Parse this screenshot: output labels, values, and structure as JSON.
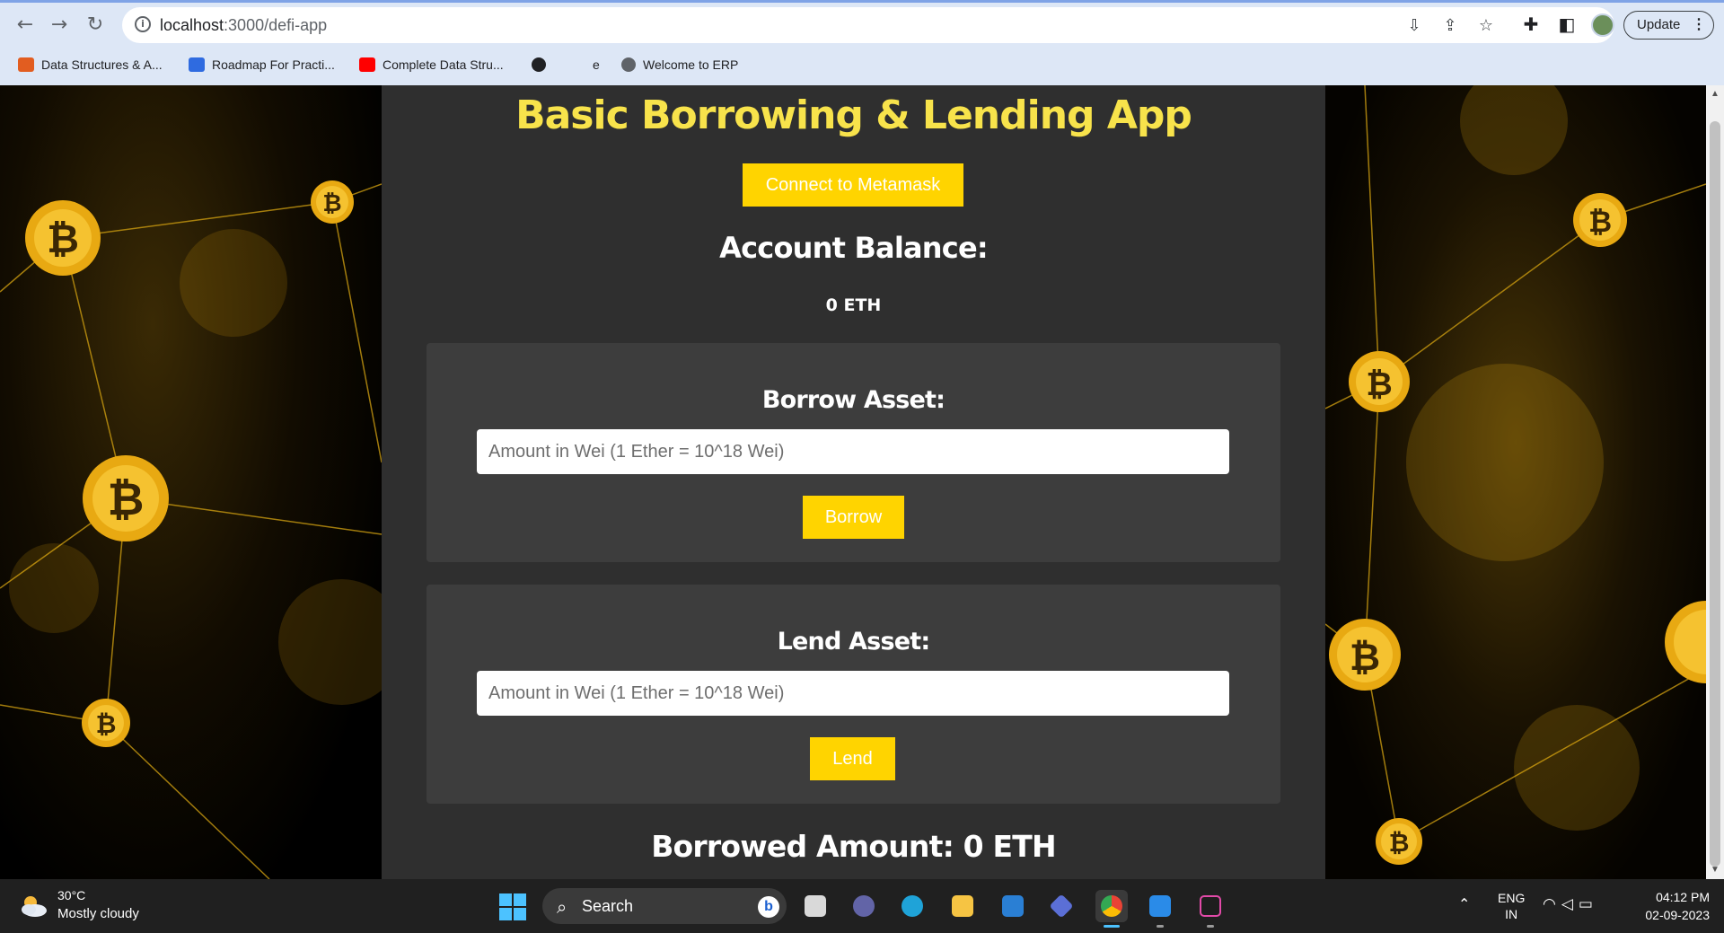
{
  "browser": {
    "url_host": "localhost",
    "url_path": ":3000/defi-app",
    "update_label": "Update",
    "bookmarks": [
      {
        "label": "Data Structures & A...",
        "icon": "codechef-icon",
        "color": "#e25d20"
      },
      {
        "label": "Roadmap For Practi...",
        "icon": "loop-icon",
        "color": "#2f6be0"
      },
      {
        "label": "Complete Data Stru...",
        "icon": "youtube-icon",
        "color": "#ff0000"
      },
      {
        "label": "",
        "icon": "globe-icon",
        "color": "#202124"
      },
      {
        "label": "e",
        "icon": "",
        "color": ""
      },
      {
        "label": "Welcome to ERP",
        "icon": "erp-icon",
        "color": "#5f6368"
      }
    ]
  },
  "app": {
    "title": "Basic Borrowing & Lending App",
    "connect_label": "Connect to Metamask",
    "balance_heading": "Account Balance:",
    "balance_value": "0 ETH",
    "borrow": {
      "title": "Borrow Asset:",
      "placeholder": "Amount in Wei (1 Ether = 10^18 Wei)",
      "button": "Borrow"
    },
    "lend": {
      "title": "Lend Asset:",
      "placeholder": "Amount in Wei (1 Ether = 10^18 Wei)",
      "button": "Lend"
    },
    "borrowed_amount": "Borrowed Amount: 0 ETH",
    "colors": {
      "accent": "#ffd400",
      "title": "#f8e34b",
      "panel": "#2f2f2f",
      "card": "#3d3d3d"
    }
  },
  "taskbar": {
    "weather_temp": "30°C",
    "weather_desc": "Mostly cloudy",
    "search_label": "Search",
    "lang_line1": "ENG",
    "lang_line2": "IN",
    "time": "04:12 PM",
    "date": "02-09-2023"
  }
}
